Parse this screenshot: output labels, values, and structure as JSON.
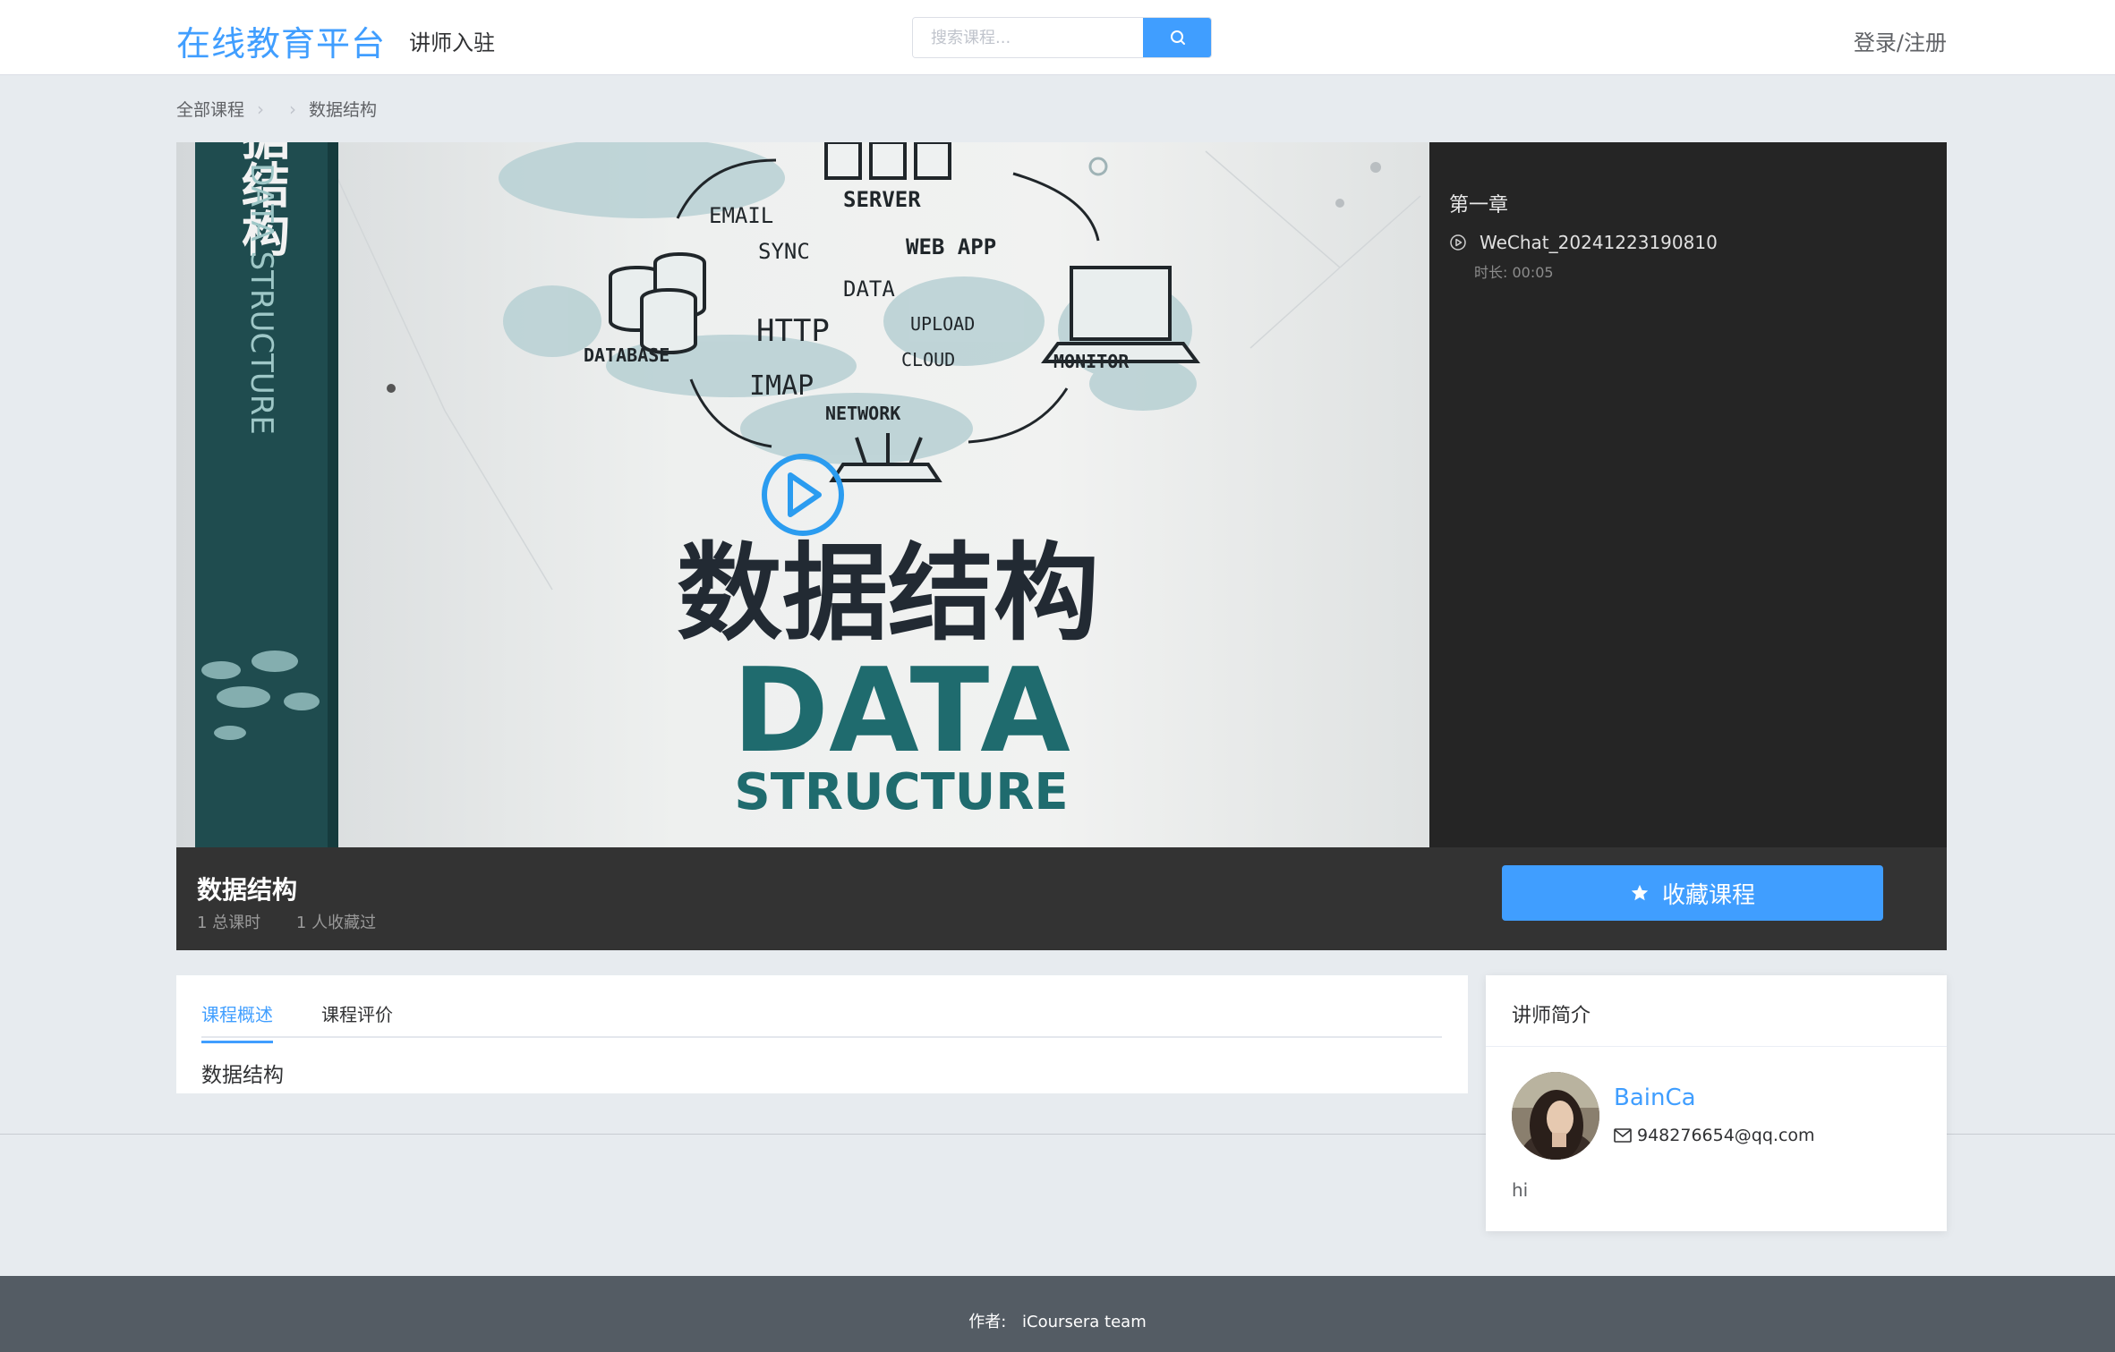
{
  "header": {
    "logo": "在线教育平台",
    "teacher_link": "讲师入驻",
    "search_placeholder": "搜索课程...",
    "login": "登录/注册"
  },
  "breadcrumb": {
    "items": [
      "全部课程",
      "",
      "数据结构"
    ]
  },
  "cover": {
    "spine_title": "数据结构",
    "spine_subtitle": "DATA STRUCTURE",
    "title_cn": "数据结构",
    "title_en_1": "DATA",
    "title_en_2": "STRUCTURE",
    "doodle_words": [
      "SERVER",
      "EMAIL",
      "SYNC",
      "WEB APP",
      "DATA",
      "HTTP",
      "UPLOAD",
      "DATABASE",
      "CLOUD",
      "MONITOR",
      "IMAP",
      "NETWORK"
    ]
  },
  "playlist": {
    "chapter": "第一章",
    "lessons": [
      {
        "name": "WeChat_20241223190810",
        "duration": "时长: 00:05"
      }
    ]
  },
  "course": {
    "title": "数据结构",
    "total_hours": "1 总课时",
    "favorites": "1 人收藏过",
    "fav_button": "收藏课程"
  },
  "tabs": {
    "overview": "课程概述",
    "reviews": "课程评价",
    "overview_text": "数据结构"
  },
  "teacher": {
    "section_title": "讲师简介",
    "name": "BainCa",
    "email": "948276654@qq.com",
    "bio": "hi"
  },
  "footer": {
    "label": "作者:",
    "value": "iCoursera team"
  },
  "colors": {
    "accent": "#409eff",
    "footer_bg": "#545c64",
    "player_bg": "#252525",
    "course_bar_bg": "#333333"
  }
}
